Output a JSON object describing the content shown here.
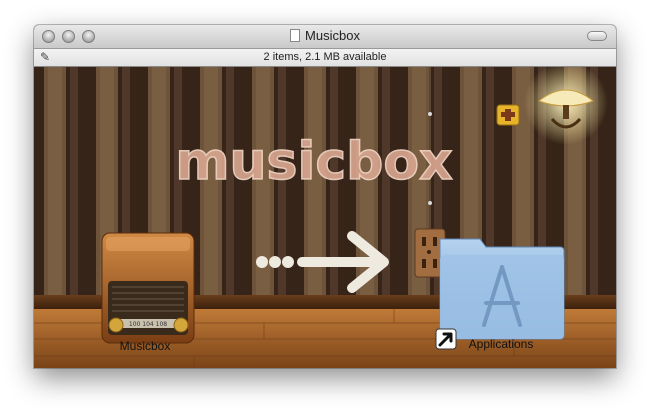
{
  "window": {
    "title": "Musicbox"
  },
  "status": {
    "text": "2 items, 2.1 MB available"
  },
  "background": {
    "headline": "musicbox"
  },
  "items": [
    {
      "label": "Musicbox",
      "icon": "radio-icon"
    },
    {
      "label": "Applications",
      "icon": "applications-folder-icon"
    }
  ],
  "icons": {
    "pen": "pen-icon",
    "arrow": "arrow-icon",
    "alias": "alias-arrow-icon",
    "lamp": "wall-lamp-icon",
    "outlet": "power-outlet-icon",
    "socket_plate": "wall-socket-icon"
  },
  "radio": {
    "dial_text": "100 104 108"
  },
  "colors": {
    "wallpaper_dark": "#3d2a1b",
    "wallpaper_light": "#8b6b4c",
    "floor": "#a86a30",
    "folder": "#8fb6de",
    "headline": "#d8a58f"
  }
}
